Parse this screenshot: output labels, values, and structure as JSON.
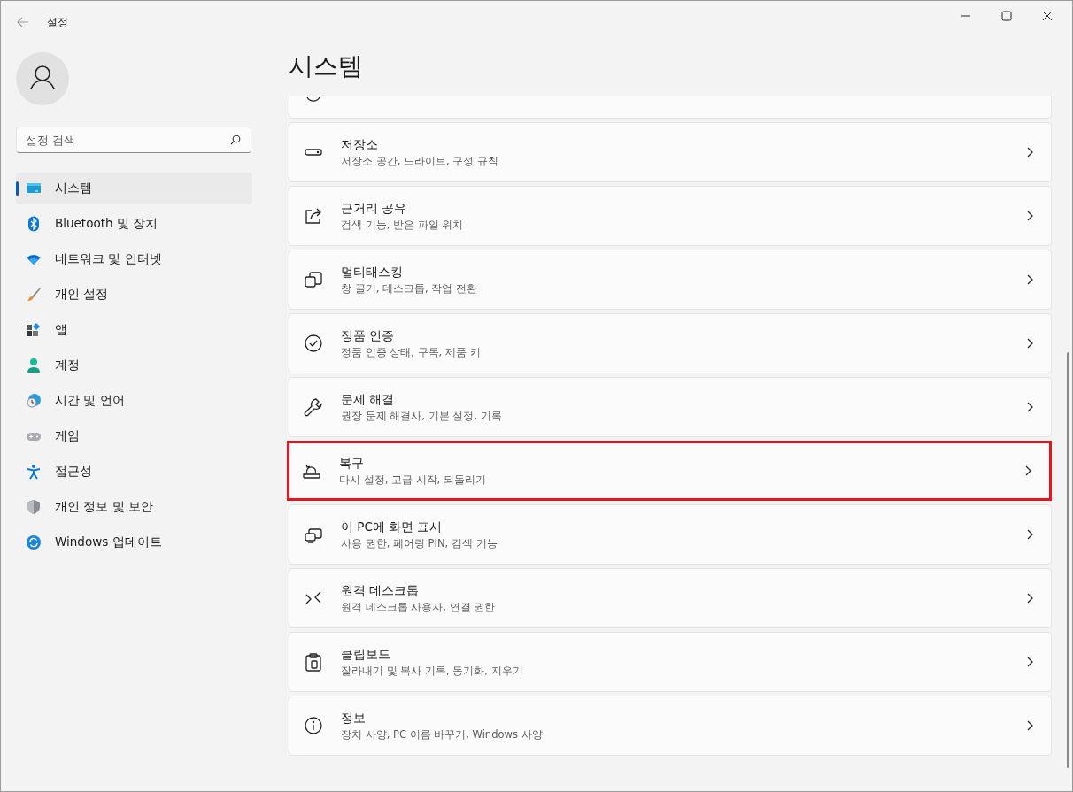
{
  "window": {
    "title": "설정"
  },
  "search": {
    "placeholder": "설정 검색"
  },
  "sidebar": {
    "items": [
      {
        "label": "시스템",
        "kind": "monitor",
        "selected": true
      },
      {
        "label": "Bluetooth 및 장치",
        "kind": "bluetooth",
        "selected": false
      },
      {
        "label": "네트워크 및 인터넷",
        "kind": "wifi",
        "selected": false
      },
      {
        "label": "개인 설정",
        "kind": "brush",
        "selected": false
      },
      {
        "label": "앱",
        "kind": "apps",
        "selected": false
      },
      {
        "label": "계정",
        "kind": "person",
        "selected": false
      },
      {
        "label": "시간 및 언어",
        "kind": "globe",
        "selected": false
      },
      {
        "label": "게임",
        "kind": "gamepad",
        "selected": false
      },
      {
        "label": "접근성",
        "kind": "accessibility",
        "selected": false
      },
      {
        "label": "개인 정보 및 보안",
        "kind": "shield",
        "selected": false
      },
      {
        "label": "Windows 업데이트",
        "kind": "update",
        "selected": false
      }
    ]
  },
  "page": {
    "title": "시스템"
  },
  "settings": [
    {
      "kind": "power",
      "highlighted": false
    },
    {
      "title": "저장소",
      "subtitle": "저장소 공간, 드라이브, 구성 규칙",
      "kind": "drive",
      "highlighted": false
    },
    {
      "title": "근거리 공유",
      "subtitle": "검색 기능, 받은 파일 위치",
      "kind": "share",
      "highlighted": false
    },
    {
      "title": "멀티태스킹",
      "subtitle": "창 끌기, 데스크톱, 작업 전환",
      "kind": "windows",
      "highlighted": false
    },
    {
      "title": "정품 인증",
      "subtitle": "정품 인증 상태, 구독, 제품 키",
      "kind": "check",
      "highlighted": false
    },
    {
      "title": "문제 해결",
      "subtitle": "권장 문제 해결사, 기본 설정, 기록",
      "kind": "wrench",
      "highlighted": false
    },
    {
      "title": "복구",
      "subtitle": "다시 설정, 고급 시작, 되돌리기",
      "kind": "recovery",
      "highlighted": true
    },
    {
      "title": "이 PC에 화면 표시",
      "subtitle": "사용 권한, 페어링 PIN, 검색 기능",
      "kind": "project",
      "highlighted": false
    },
    {
      "title": "원격 데스크톱",
      "subtitle": "원격 데스크톱 사용자, 연결 권한",
      "kind": "remote",
      "highlighted": false
    },
    {
      "title": "클립보드",
      "subtitle": "잘라내기 및 복사 기록, 동기화, 지우기",
      "kind": "clipboard",
      "highlighted": false
    },
    {
      "title": "정보",
      "subtitle": "장치 사양, PC 이름 바꾸기, Windows 사양",
      "kind": "info",
      "highlighted": false
    }
  ]
}
